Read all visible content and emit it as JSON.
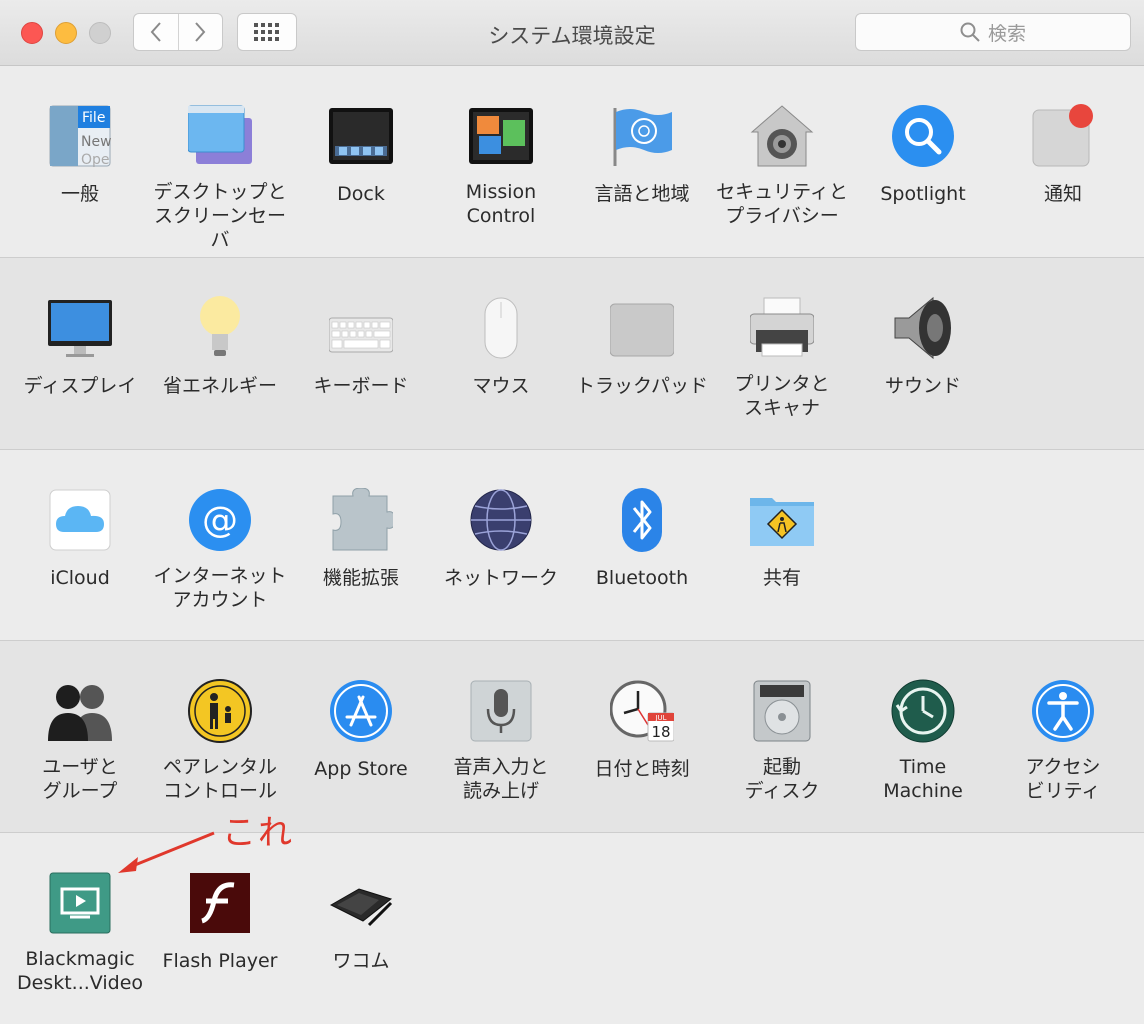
{
  "window": {
    "title": "システム環境設定",
    "search_placeholder": "検索"
  },
  "sections": [
    [
      {
        "name": "general",
        "label": "一般",
        "icon": "general-icon"
      },
      {
        "name": "desktop",
        "label": "デスクトップと\nスクリーンセーバ",
        "icon": "desktop-screensaver-icon"
      },
      {
        "name": "dock",
        "label": "Dock",
        "icon": "dock-icon"
      },
      {
        "name": "mission-control",
        "label": "Mission\nControl",
        "icon": "mission-control-icon"
      },
      {
        "name": "language-region",
        "label": "言語と地域",
        "icon": "flag-icon"
      },
      {
        "name": "security",
        "label": "セキュリティと\nプライバシー",
        "icon": "security-house-icon"
      },
      {
        "name": "spotlight",
        "label": "Spotlight",
        "icon": "magnifier-icon"
      },
      {
        "name": "notifications",
        "label": "通知",
        "icon": "notifications-icon"
      }
    ],
    [
      {
        "name": "displays",
        "label": "ディスプレイ",
        "icon": "monitor-icon"
      },
      {
        "name": "energy",
        "label": "省エネルギー",
        "icon": "lightbulb-icon"
      },
      {
        "name": "keyboard",
        "label": "キーボード",
        "icon": "keyboard-icon"
      },
      {
        "name": "mouse",
        "label": "マウス",
        "icon": "mouse-icon"
      },
      {
        "name": "trackpad",
        "label": "トラックパッド",
        "icon": "trackpad-icon"
      },
      {
        "name": "printers",
        "label": "プリンタと\nスキャナ",
        "icon": "printer-icon"
      },
      {
        "name": "sound",
        "label": "サウンド",
        "icon": "speaker-icon"
      }
    ],
    [
      {
        "name": "icloud",
        "label": "iCloud",
        "icon": "cloud-icon"
      },
      {
        "name": "internet-accounts",
        "label": "インターネット\nアカウント",
        "icon": "at-sign-icon"
      },
      {
        "name": "extensions",
        "label": "機能拡張",
        "icon": "puzzle-icon"
      },
      {
        "name": "network",
        "label": "ネットワーク",
        "icon": "globe-network-icon"
      },
      {
        "name": "bluetooth",
        "label": "Bluetooth",
        "icon": "bluetooth-icon"
      },
      {
        "name": "sharing",
        "label": "共有",
        "icon": "shared-folder-icon"
      }
    ],
    [
      {
        "name": "users-groups",
        "label": "ユーザと\nグループ",
        "icon": "users-icon"
      },
      {
        "name": "parental-controls",
        "label": "ペアレンタル\nコントロール",
        "icon": "parental-icon"
      },
      {
        "name": "app-store",
        "label": "App Store",
        "icon": "app-store-icon"
      },
      {
        "name": "dictation",
        "label": "音声入力と\n読み上げ",
        "icon": "microphone-icon"
      },
      {
        "name": "date-time",
        "label": "日付と時刻",
        "icon": "clock-calendar-icon"
      },
      {
        "name": "startup-disk",
        "label": "起動\nディスク",
        "icon": "hard-disk-icon"
      },
      {
        "name": "time-machine",
        "label": "Time\nMachine",
        "icon": "time-machine-icon"
      },
      {
        "name": "accessibility",
        "label": "アクセシ\nビリティ",
        "icon": "accessibility-icon"
      }
    ],
    [
      {
        "name": "blackmagic",
        "label": "Blackmagic\nDeskt...Video",
        "icon": "blackmagic-icon"
      },
      {
        "name": "flash-player",
        "label": "Flash Player",
        "icon": "flash-icon"
      },
      {
        "name": "wacom",
        "label": "ワコム",
        "icon": "tablet-icon"
      }
    ]
  ],
  "calendar_icon": {
    "month": "JUL",
    "day": "18"
  },
  "general_icon_text": [
    "File",
    "New",
    "Ope"
  ],
  "annotation": {
    "text": "これ",
    "color": "#e0382c"
  }
}
